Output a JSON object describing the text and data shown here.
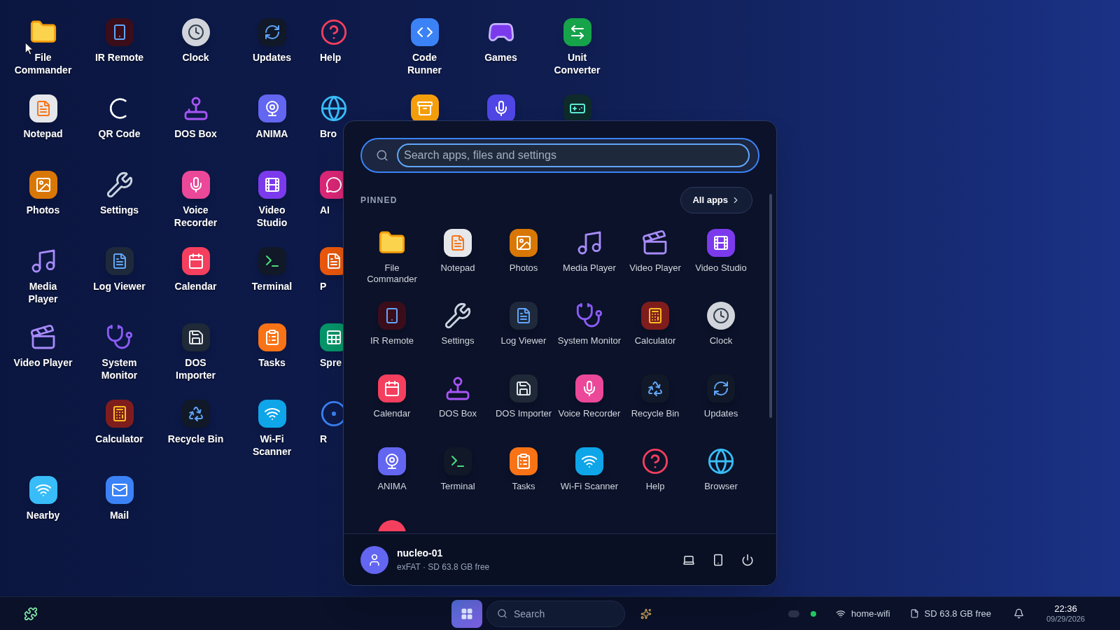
{
  "desktop": {
    "rows": [
      {
        "icons": [
          {
            "label": "File Commander",
            "kind": "folder"
          },
          {
            "label": "IR Remote",
            "kind": "remote"
          },
          {
            "label": "Clock",
            "kind": "clock"
          },
          {
            "label": "Updates",
            "kind": "updates"
          },
          {
            "label": "Help",
            "kind": "help"
          },
          {
            "label": "Code Runner",
            "kind": "code"
          },
          {
            "label": "Games",
            "kind": "games"
          },
          {
            "label": "Unit Converter",
            "kind": "converter"
          }
        ]
      },
      {
        "icons": [
          {
            "label": "Notepad",
            "kind": "notepad"
          },
          {
            "label": "QR Code",
            "kind": "qr"
          },
          {
            "label": "DOS Box",
            "kind": "joystick"
          },
          {
            "label": "ANIMA",
            "kind": "anima"
          },
          {
            "label": "Bro",
            "kind": "globe"
          },
          {
            "kind": "archive"
          },
          {
            "kind": "assistant"
          },
          {
            "kind": "controller"
          }
        ]
      },
      {
        "icons": [
          {
            "label": "Photos",
            "kind": "photos"
          },
          {
            "label": "Settings",
            "kind": "settings"
          },
          {
            "label": "Voice Recorder",
            "kind": "voice"
          },
          {
            "label": "Video Studio",
            "kind": "studio"
          },
          {
            "label": "AI",
            "kind": "ai"
          }
        ]
      },
      {
        "icons": [
          {
            "label": "Media Player",
            "kind": "media"
          },
          {
            "label": "Log Viewer",
            "kind": "log"
          },
          {
            "label": "Calendar",
            "kind": "calendar"
          },
          {
            "label": "Terminal",
            "kind": "terminal"
          },
          {
            "label": "P",
            "kind": "document"
          }
        ]
      },
      {
        "icons": [
          {
            "label": "Video Player",
            "kind": "clapper"
          },
          {
            "label": "System Monitor",
            "kind": "monitor"
          },
          {
            "label": "DOS Importer",
            "kind": "dos"
          },
          {
            "label": "Tasks",
            "kind": "tasks"
          },
          {
            "label": "Spre",
            "kind": "sheet"
          }
        ]
      },
      {
        "icons": [
          {
            "label": "Calculator",
            "kind": "calculator"
          },
          {
            "label": "Recycle Bin",
            "kind": "recycle"
          },
          {
            "label": "Wi-Fi Scanner",
            "kind": "wifi"
          },
          {
            "label": "R",
            "kind": "radar"
          }
        ]
      },
      {
        "icons": [
          {
            "label": "Nearby",
            "kind": "nearby"
          },
          {
            "label": "Mail",
            "kind": "mail"
          }
        ]
      }
    ]
  },
  "start_menu": {
    "open": true,
    "search": {
      "placeholder": "Search apps, files and settings"
    },
    "section_title": "PINNED",
    "all_apps_button": "All apps",
    "pinned": [
      {
        "label": "File Commander",
        "kind": "folder"
      },
      {
        "label": "Notepad",
        "kind": "notepad"
      },
      {
        "label": "Photos",
        "kind": "photos"
      },
      {
        "label": "Media Player",
        "kind": "media"
      },
      {
        "label": "Video Player",
        "kind": "clapper"
      },
      {
        "label": "Video Studio",
        "kind": "studio"
      },
      {
        "label": "IR Remote",
        "kind": "remote"
      },
      {
        "label": "Settings",
        "kind": "settings"
      },
      {
        "label": "Log Viewer",
        "kind": "log"
      },
      {
        "label": "System Monitor",
        "kind": "monitor"
      },
      {
        "label": "Calculator",
        "kind": "calculator"
      },
      {
        "label": "Clock",
        "kind": "clock"
      },
      {
        "label": "Calendar",
        "kind": "calendar"
      },
      {
        "label": "DOS Box",
        "kind": "joystick"
      },
      {
        "label": "DOS Importer",
        "kind": "dos"
      },
      {
        "label": "Voice Recorder",
        "kind": "voice"
      },
      {
        "label": "Recycle Bin",
        "kind": "recycle"
      },
      {
        "label": "Updates",
        "kind": "updates"
      },
      {
        "label": "ANIMA",
        "kind": "anima"
      },
      {
        "label": "Terminal",
        "kind": "terminal"
      },
      {
        "label": "Tasks",
        "kind": "tasks"
      },
      {
        "label": "Wi-Fi Scanner",
        "kind": "wifi"
      },
      {
        "label": "Help",
        "kind": "help"
      },
      {
        "label": "Browser",
        "kind": "globe"
      },
      {
        "kind": "more"
      }
    ],
    "user": {
      "name": "nucleo-01",
      "detail": "exFAT · SD 63.8 GB free"
    }
  },
  "taskbar": {
    "start_selected": true,
    "search": {
      "placeholder": "Search"
    },
    "toggle_on": false,
    "status_dot": {
      "color": "#22c55e"
    },
    "wifi": "home-wifi",
    "storage": "SD 63.8 GB free",
    "time": "22:36",
    "date": "09/29/2026"
  }
}
